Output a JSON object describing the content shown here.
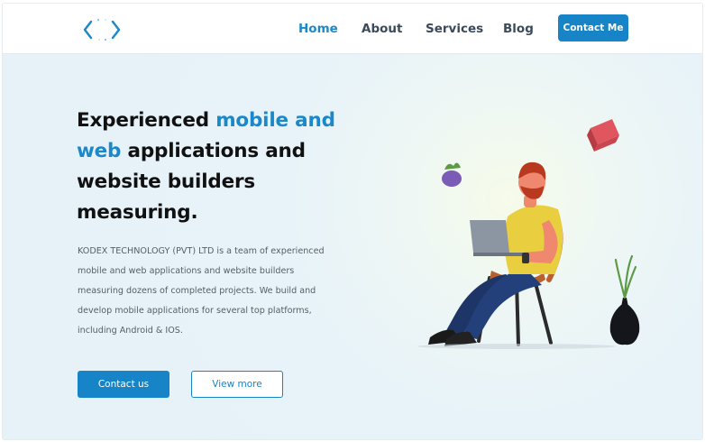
{
  "nav": {
    "items": [
      {
        "label": "Home",
        "active": true
      },
      {
        "label": "About",
        "active": false
      },
      {
        "label": "Services",
        "active": false
      },
      {
        "label": "Blog",
        "active": false
      }
    ],
    "cta_label": "Contact Me"
  },
  "hero": {
    "headline_parts": [
      "Experienced ",
      "mobile and web",
      " applications and website builders measuring."
    ],
    "description": "KODEX TECHNOLOGY (PVT) LTD is a team of experienced mobile and web applications and website builders measuring dozens of completed projects. We build and develop mobile applications for several top platforms, including Android & IOS.",
    "primary_button": "Contact us",
    "secondary_button": "View more"
  },
  "colors": {
    "accent": "#1b88c9",
    "button": "#1684c6",
    "hero_bg": "#e8f3f9"
  },
  "icons": {
    "logo": "code-brackets-logo-icon"
  }
}
